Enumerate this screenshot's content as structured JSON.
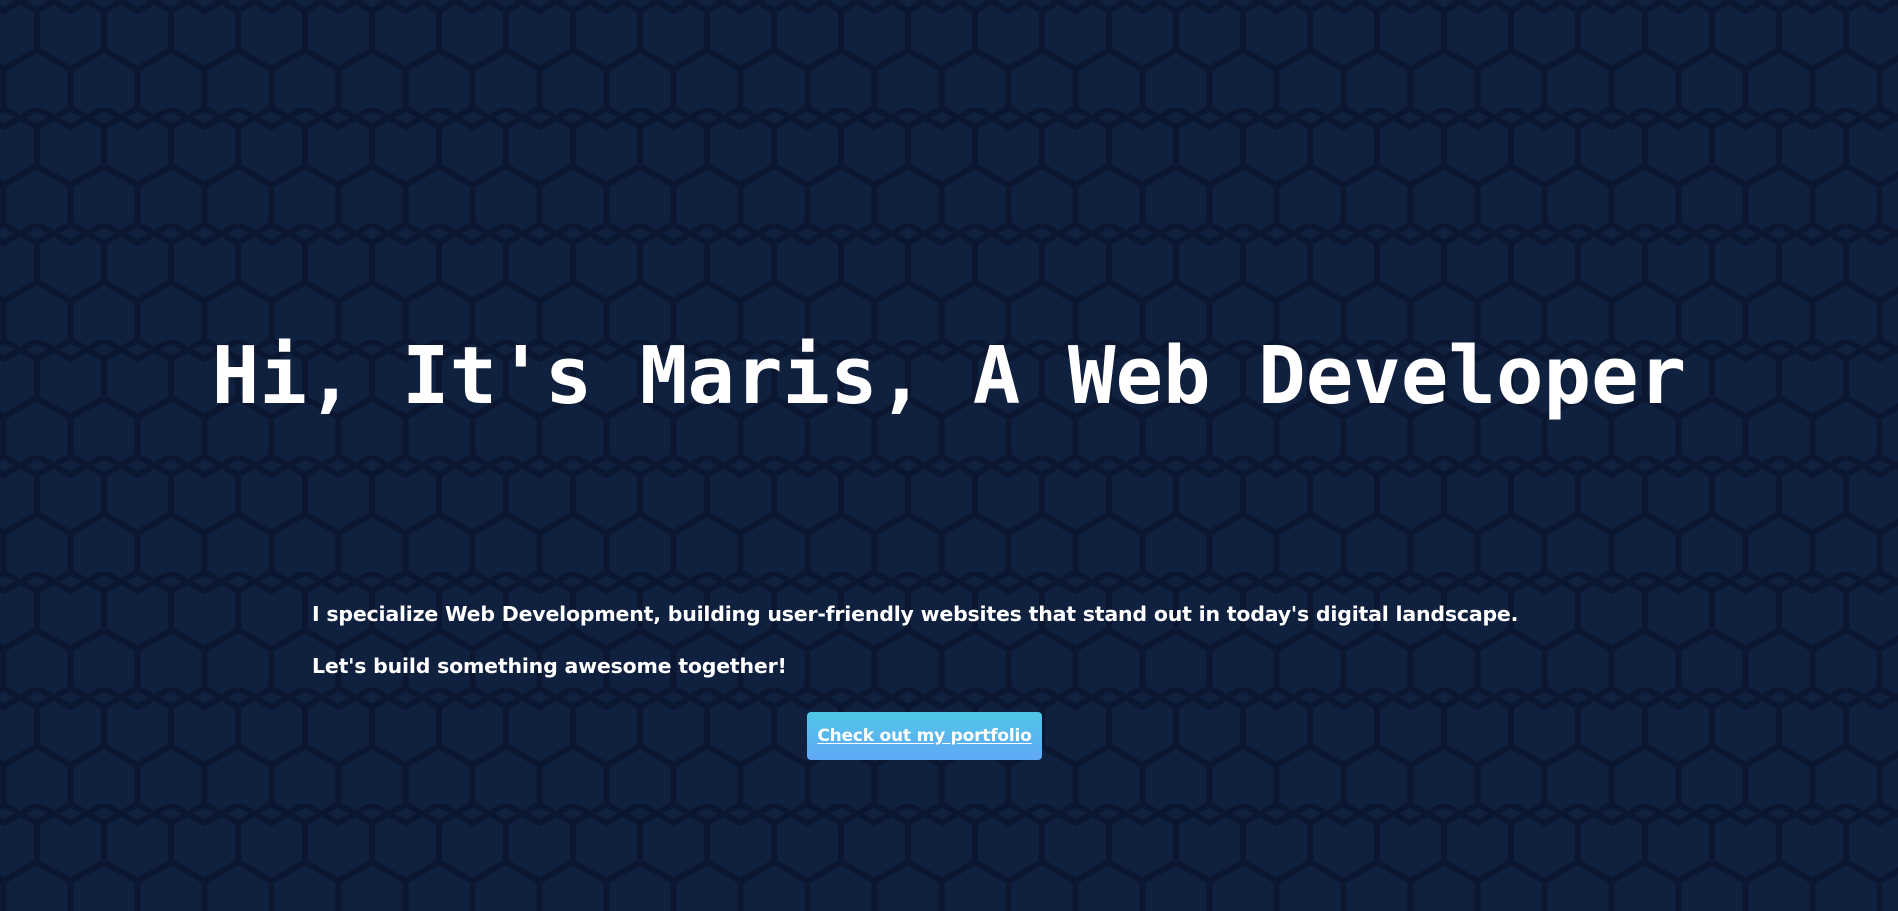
{
  "hero": {
    "title": "Hi, It's Maris, A Web Developer",
    "paragraph_1": "I specialize Web Development, building user-friendly websites that stand out in today's digital landscape.",
    "paragraph_2": "Let's build something awesome together!",
    "cta_label": "Check out my portfolio"
  },
  "colors": {
    "background": "#10203f",
    "hex_outline": "#0b1730",
    "text": "#ffffff",
    "button_gradient_top": "#4fc7e6",
    "button_gradient_bottom": "#61a8f7"
  }
}
